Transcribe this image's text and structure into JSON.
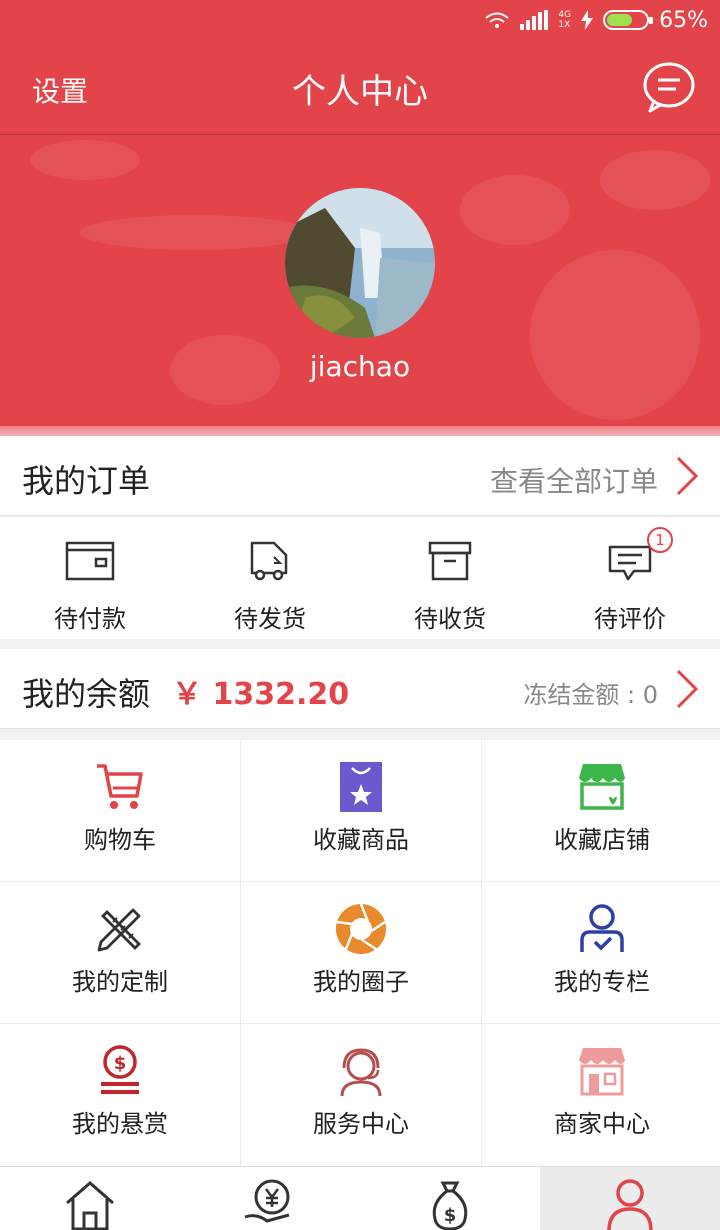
{
  "status_bar": {
    "network_top": "4G",
    "network_bottom": "1X",
    "battery": "65%",
    "battery_level": 0.65
  },
  "header": {
    "left_label": "设置",
    "title": "个人中心"
  },
  "profile": {
    "username": "jiachao"
  },
  "orders": {
    "title": "我的订单",
    "view_all": "查看全部订单",
    "statuses": [
      {
        "label": "待付款",
        "icon": "wallet-icon"
      },
      {
        "label": "待发货",
        "icon": "truck-icon"
      },
      {
        "label": "待收货",
        "icon": "box-icon"
      },
      {
        "label": "待评价",
        "icon": "comment-icon",
        "badge": "1"
      }
    ]
  },
  "balance": {
    "title": "我的余额",
    "amount": "￥ 1332.20",
    "frozen": "冻结金额 : 0"
  },
  "grid": [
    {
      "label": "购物车",
      "icon": "cart-icon"
    },
    {
      "label": "收藏商品",
      "icon": "favorite-goods-icon"
    },
    {
      "label": "收藏店铺",
      "icon": "favorite-store-icon"
    },
    {
      "label": "我的定制",
      "icon": "pencil-ruler-icon"
    },
    {
      "label": "我的圈子",
      "icon": "aperture-icon"
    },
    {
      "label": "我的专栏",
      "icon": "user-column-icon"
    },
    {
      "label": "我的悬赏",
      "icon": "reward-coin-icon"
    },
    {
      "label": "服务中心",
      "icon": "headset-icon"
    },
    {
      "label": "商家中心",
      "icon": "shop-icon"
    }
  ],
  "tabbar": [
    {
      "icon": "home-icon"
    },
    {
      "icon": "finance-icon"
    },
    {
      "icon": "money-bag-icon"
    },
    {
      "icon": "profile-icon"
    }
  ],
  "colors": {
    "primary": "#e2444a",
    "purple": "#6a5acd",
    "green": "#3cb54a",
    "orange": "#e8892b",
    "blue": "#2c3fa6"
  }
}
